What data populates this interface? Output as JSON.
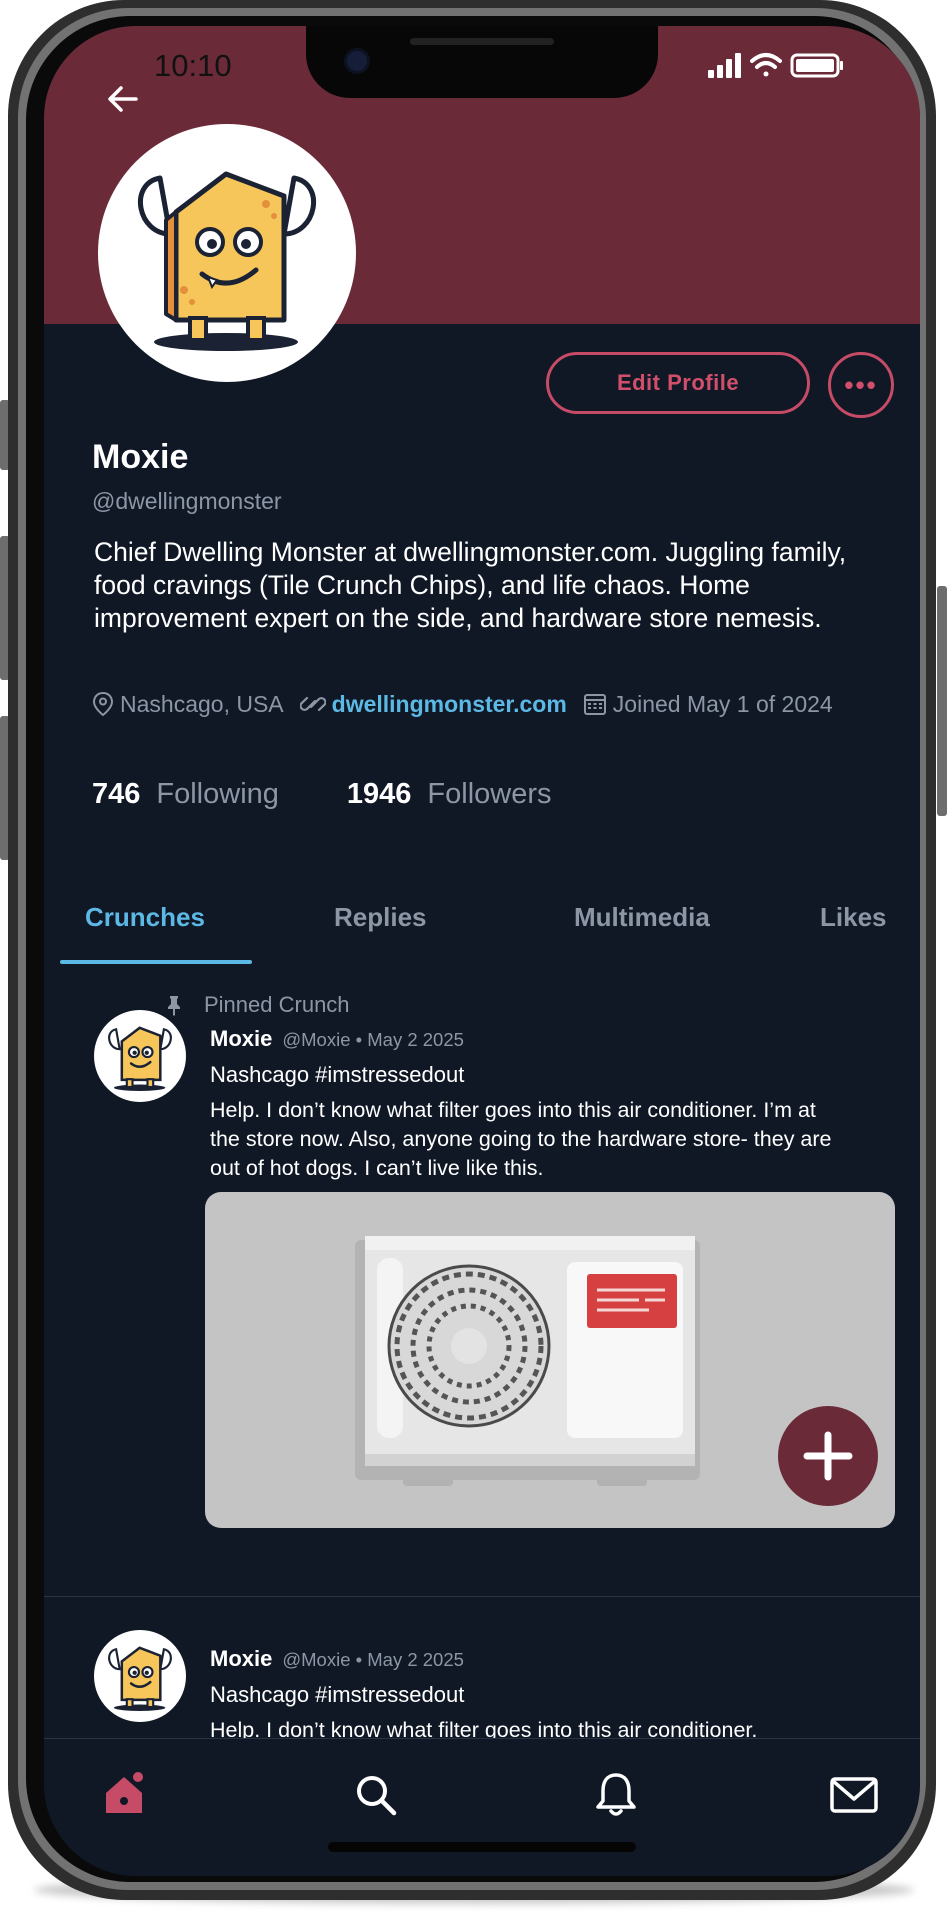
{
  "status_bar": {
    "time": "10:10"
  },
  "profile": {
    "name": "Moxie",
    "handle": "@dwellingmonster",
    "bio": "Chief Dwelling Monster at dwellingmonster.com. Juggling family, food cravings (Tile Crunch Chips), and life chaos. Home improvement expert on the side, and hardware store nemesis.",
    "location": "Nashcago, USA",
    "website": "dwellingmonster.com",
    "joined": "Joined May 1 of 2024",
    "edit_label": "Edit Profile",
    "more_label": "•••"
  },
  "stats": {
    "following_count": "746",
    "following_label": "Following",
    "followers_count": "1946",
    "followers_label": "Followers"
  },
  "tabs": [
    {
      "label": "Crunches",
      "active": true
    },
    {
      "label": "Replies"
    },
    {
      "label": "Multimedia"
    },
    {
      "label": "Likes"
    }
  ],
  "pinned_label": "Pinned Crunch",
  "posts": [
    {
      "name": "Moxie",
      "meta": "@Moxie • May 2 2025",
      "line": "Nashcago #imstressedout",
      "body": "Help. I don’t know what filter goes into this air conditioner. I’m at the store now. Also, anyone going to the hardware store- they are out of hot dogs. I can’t live like this."
    },
    {
      "name": "Moxie",
      "meta": "@Moxie • May 2 2025",
      "line": "Nashcago #imstressedout",
      "body": "Help. I don’t know what filter goes into this air conditioner."
    }
  ],
  "colors": {
    "banner": "#6b2a38",
    "background": "#101826",
    "accent_blue": "#5cb8e4",
    "accent_pink": "#d24f6c"
  },
  "icons": {
    "back": "arrow-left-icon",
    "location": "map-pin-icon",
    "link": "link-icon",
    "calendar": "calendar-icon",
    "pin": "pushpin-icon",
    "fab": "plus-icon",
    "nav": [
      "home-icon",
      "search-icon",
      "bell-icon",
      "mail-icon"
    ]
  }
}
